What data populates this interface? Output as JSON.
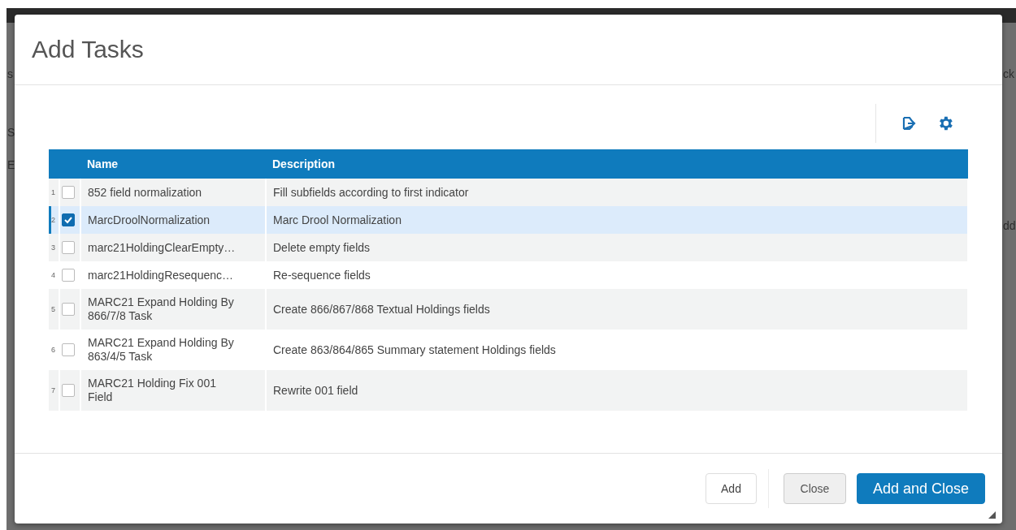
{
  "background": {
    "left_fragments": [
      "s",
      "S",
      "E"
    ],
    "right_fragments": [
      "ck",
      "dd"
    ]
  },
  "dialog": {
    "title": "Add Tasks"
  },
  "table": {
    "columns": [
      "Name",
      "Description"
    ],
    "rows": [
      {
        "number": "1",
        "name": "852 field normalization",
        "description": "Fill subfields according to first indicator",
        "checked": false,
        "selected": false
      },
      {
        "number": "2",
        "name": "MarcDroolNormalization",
        "description": "Marc Drool Normalization",
        "checked": true,
        "selected": true
      },
      {
        "number": "3",
        "name": "marc21HoldingClearEmpty…",
        "description": "Delete empty fields",
        "checked": false,
        "selected": false
      },
      {
        "number": "4",
        "name": "marc21HoldingResequenc…",
        "description": "Re-sequence fields",
        "checked": false,
        "selected": false
      },
      {
        "number": "5",
        "name": "MARC21 Expand Holding By 866/7/8 Task",
        "description": "Create 866/867/868 Textual Holdings fields",
        "checked": false,
        "selected": false
      },
      {
        "number": "6",
        "name": "MARC21 Expand Holding By 863/4/5 Task",
        "description": "Create 863/864/865 Summary statement Holdings fields",
        "checked": false,
        "selected": false
      },
      {
        "number": "7",
        "name": "MARC21 Holding Fix 001 Field",
        "description": "Rewrite 001 field",
        "checked": false,
        "selected": false
      }
    ]
  },
  "buttons": [
    {
      "label": "Add",
      "kind": "outline"
    },
    {
      "label": "Close",
      "kind": "secondary"
    },
    {
      "label": "Add and Close",
      "kind": "primary"
    }
  ]
}
